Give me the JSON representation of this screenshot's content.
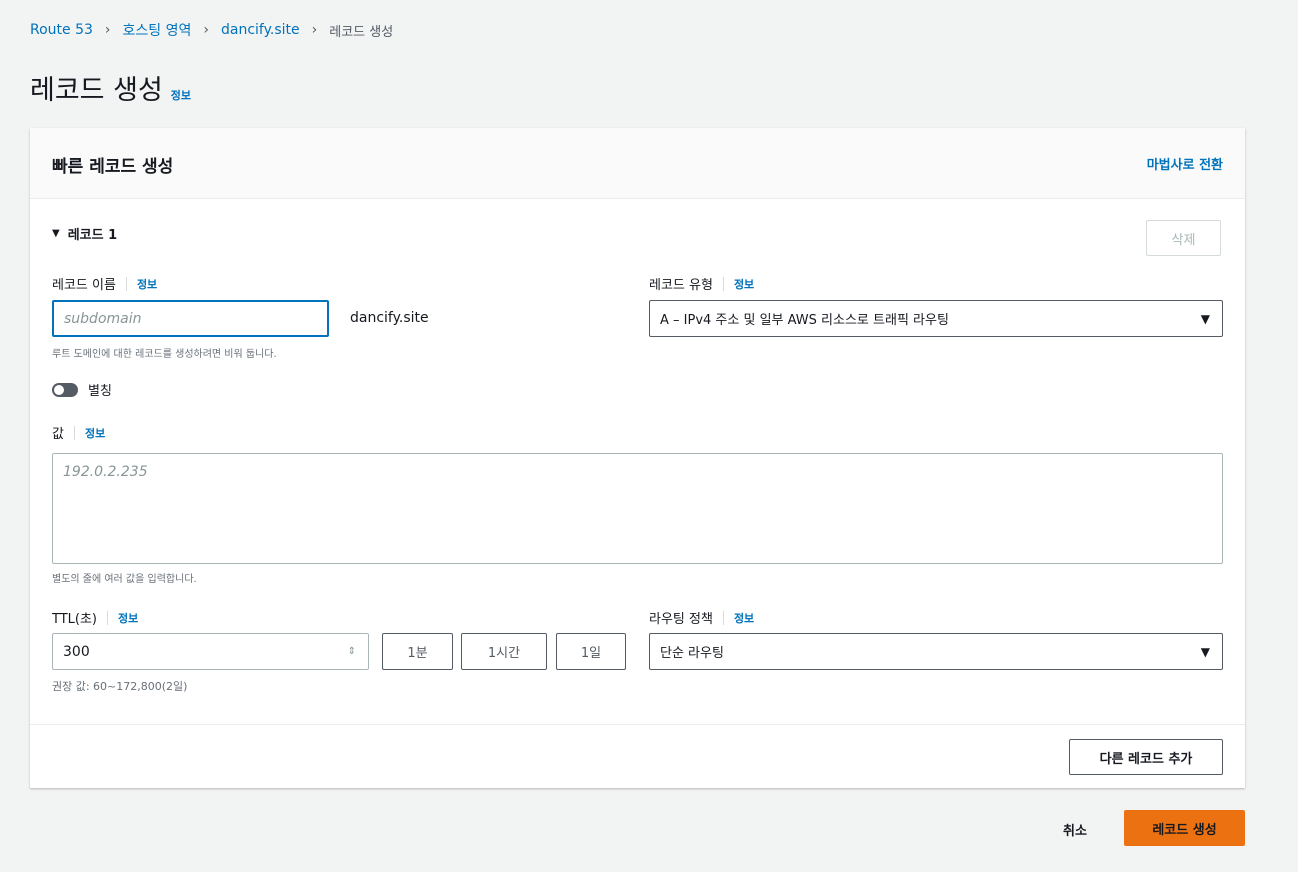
{
  "breadcrumb": {
    "items": [
      "Route 53",
      "호스팅 영역",
      "dancify.site"
    ],
    "current": "레코드 생성"
  },
  "page": {
    "title": "레코드 생성",
    "info": "정보"
  },
  "card": {
    "title": "빠른 레코드 생성",
    "wizard_link": "마법사로 전환"
  },
  "record": {
    "section_label": "레코드 1",
    "delete_label": "삭제",
    "name": {
      "label": "레코드 이름",
      "info": "정보",
      "placeholder": "subdomain",
      "suffix": "dancify.site",
      "hint": "루트 도메인에 대한 레코드를 생성하려면 비워 둡니다."
    },
    "type": {
      "label": "레코드 유형",
      "info": "정보",
      "selected": "A – IPv4 주소 및 일부 AWS 리소스로 트래픽 라우팅"
    },
    "alias": {
      "label": "별칭",
      "enabled": false
    },
    "value": {
      "label": "값",
      "info": "정보",
      "placeholder": "192.0.2.235",
      "hint": "별도의 줄에 여러 값을 입력합니다."
    },
    "ttl": {
      "label": "TTL(초)",
      "info": "정보",
      "value": "300",
      "presets": [
        "1분",
        "1시간",
        "1일"
      ],
      "hint": "권장 값: 60~172,800(2일)"
    },
    "routing": {
      "label": "라우팅 정책",
      "info": "정보",
      "selected": "단순 라우팅"
    }
  },
  "add_record_label": "다른 레코드 추가",
  "footer": {
    "cancel_label": "취소",
    "create_label": "레코드 생성"
  },
  "colors": {
    "link": "#0073bb",
    "primary": "#ec7211",
    "background": "#f2f3f3"
  }
}
